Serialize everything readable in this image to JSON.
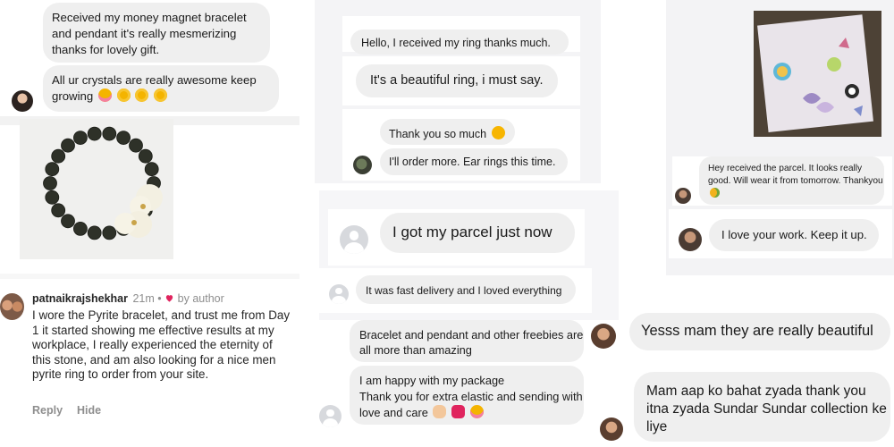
{
  "left": {
    "messages": [
      "Received my money magnet bracelet and pendant it's really mesmerizing thanks for lovely gift.",
      "All ur crystals are really awesome keep growing"
    ],
    "comment": {
      "username": "patnaikrajshekhar",
      "time": "21m",
      "separator": "•",
      "by_author": "by author",
      "text": "I wore the Pyrite bracelet, and trust me from Day 1 it started showing me effective results at my workplace, I really experienced the eternity of this stone, and am also looking for a nice men pyrite ring to order from your site.",
      "reply_label": "Reply",
      "hide_label": "Hide"
    }
  },
  "middle": {
    "messages": [
      "Hello, I received my ring thanks much.",
      "It's a beautiful ring, i must say.",
      "Thank you so much",
      "I'll order more. Ear rings this time.",
      "I got my parcel just now",
      "It was fast delivery and I loved everything",
      "Bracelet and pendant and other freebies are all more than amazing",
      "I am happy with my package",
      "Thank you for extra elastic and sending with love and care"
    ]
  },
  "right": {
    "messages": [
      "Hey received the parcel. It looks really good. Will wear it from tomorrow. Thankyou",
      "I love your work. Keep it up.",
      "Yesss mam they are really beautiful",
      "Mam aap ko bahat zyada thank you itna zyada Sundar Sundar collection ke liye"
    ]
  },
  "icons": [
    "heart-icon",
    "smiling-face-hearts-emoji",
    "kissing-face-emoji",
    "smiling-face-emoji",
    "mango-emoji",
    "heart-hands-emoji",
    "red-heart-emoji",
    "default-avatar-icon"
  ],
  "colors": {
    "bubble": "#efefef",
    "heart": "#e0245e",
    "panel": "#f4f4f6",
    "meta_text": "#8e8e8e"
  }
}
